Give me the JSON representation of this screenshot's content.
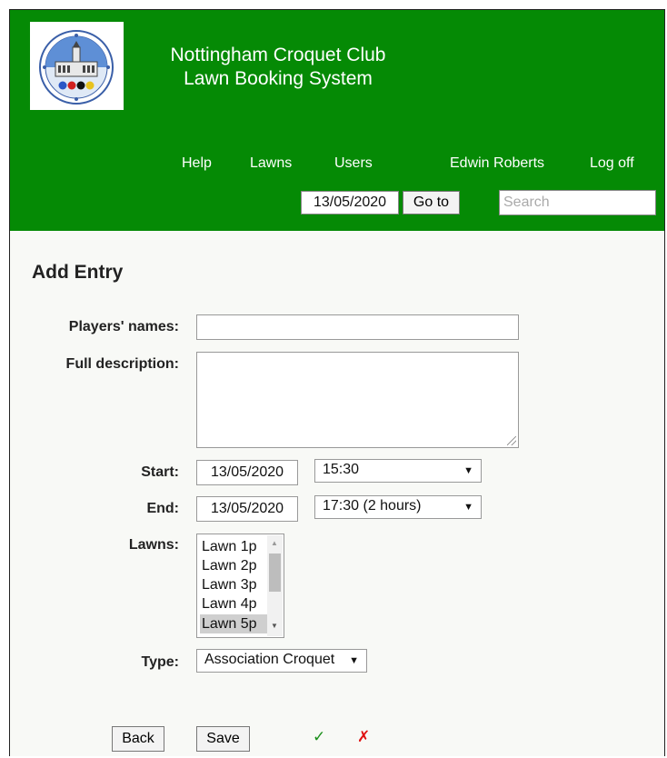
{
  "header": {
    "title_line1": "Nottingham Croquet Club",
    "title_line2": "Lawn Booking System",
    "nav": {
      "help": "Help",
      "lawns": "Lawns",
      "users": "Users",
      "user_name": "Edwin Roberts",
      "log_off": "Log off"
    },
    "date_value": "13/05/2020",
    "goto_label": "Go to",
    "search_placeholder": "Search"
  },
  "form": {
    "heading": "Add Entry",
    "players_label": "Players' names:",
    "players_value": "",
    "description_label": "Full description:",
    "description_value": "",
    "start_label": "Start:",
    "start_date": "13/05/2020",
    "start_time": "15:30",
    "end_label": "End:",
    "end_date": "13/05/2020",
    "end_time": "17:30  (2 hours)",
    "lawns_label": "Lawns:",
    "lawns": [
      "Lawn 1p",
      "Lawn 2p",
      "Lawn 3p",
      "Lawn 4p",
      "Lawn 5p"
    ],
    "lawn_selected": "Lawn 5p",
    "type_label": "Type:",
    "type_value": "Association Croquet"
  },
  "actions": {
    "back_label": "Back",
    "save_label": "Save",
    "valid_mark": "✓",
    "invalid_mark": "✗"
  },
  "icons": {
    "logo": "club-crest-icon",
    "dropdown": "triangle-down-icon",
    "valid": "check-icon",
    "invalid": "cross-icon"
  },
  "colors": {
    "banner": "#058a05",
    "page_bg": "#f8f9f6",
    "check": "#1a8f1a",
    "cross": "#e01010"
  }
}
